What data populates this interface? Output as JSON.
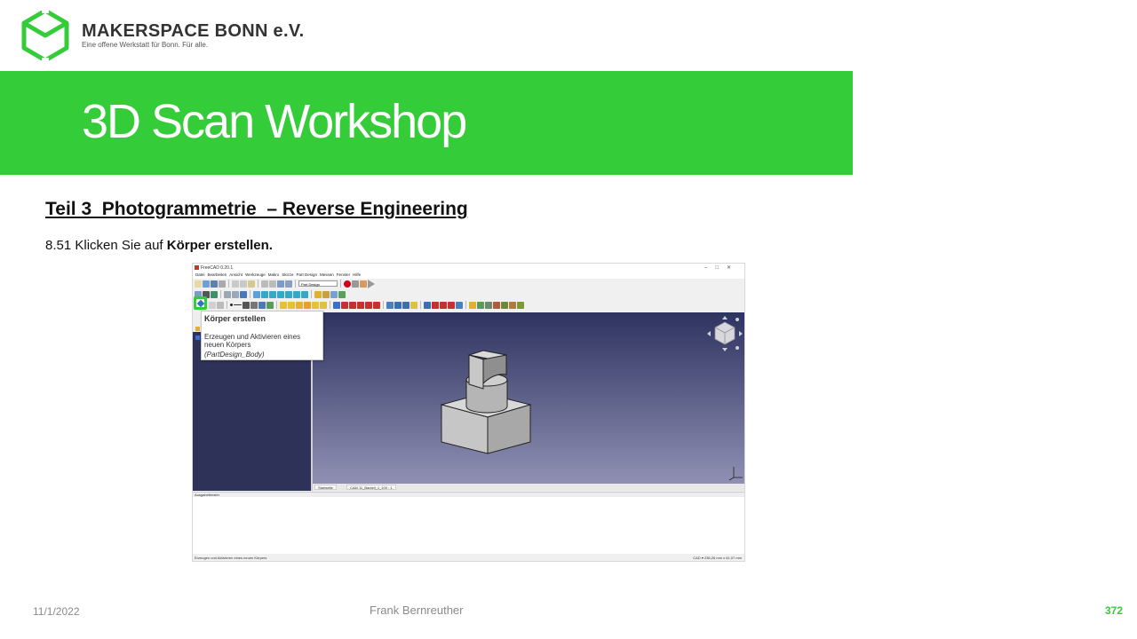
{
  "header": {
    "org_name": "MAKERSPACE BONN e.V.",
    "org_tagline": "Eine offene Werkstatt für Bonn. Für alle.",
    "accent_color": "#34cc38"
  },
  "banner": {
    "title": "3D Scan Workshop"
  },
  "content": {
    "section_title": "Teil 3  Photogrammetrie  – Reverse Engineering",
    "step_prefix": "8.51 Klicken Sie auf ",
    "step_bold": "Körper erstellen."
  },
  "screenshot": {
    "window_title": "FreeCAD 0.20.1",
    "window_controls": "–□✕",
    "menu": [
      "Datei",
      "Bearbeiten",
      "Ansicht",
      "Werkzeuge",
      "Makro",
      "Skizze",
      "Part Design",
      "Messen",
      "Fenster",
      "Hilfe"
    ],
    "workbench": "Part Design",
    "tooltip": {
      "title": "Körper erstellen",
      "description": "Erzeugen und Aktivieren eines neuen Körpers",
      "command": "(PartDesign_Body)"
    },
    "doc_tabs": [
      "Startseite",
      "CAM 11_Bauteil_1_100 : 1"
    ],
    "output_panel": "Ausgabefenster",
    "status_left": "Erzeugen und Aktivieren eines neuen Körpers",
    "status_right": "CAD ▾   236,26 mm x 61,07 mm"
  },
  "footer": {
    "date": "11/1/2022",
    "author": "Frank Bernreuther",
    "page": "372"
  }
}
